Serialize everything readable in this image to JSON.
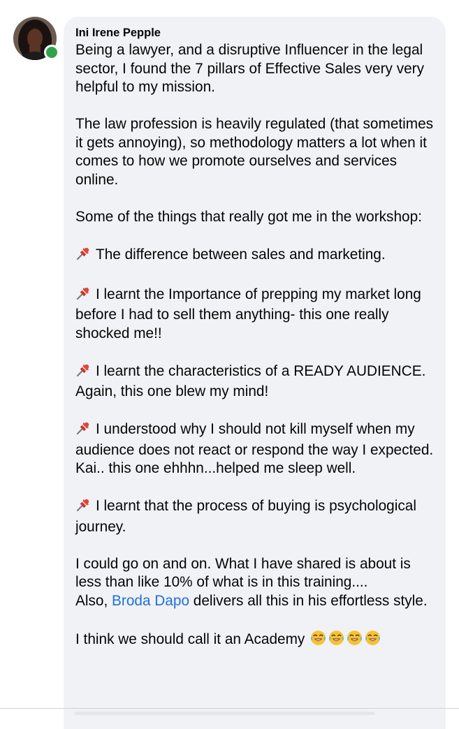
{
  "comment": {
    "author": "Ini Irene Pepple",
    "online": true,
    "paragraphs": [
      {
        "pinned": false,
        "text": "Being a lawyer, and a disruptive Influencer  in the legal sector, I found the 7 pillars of Effective Sales very very helpful to my mission."
      },
      {
        "pinned": false,
        "text": "The law profession is heavily regulated (that sometimes it gets annoying), so methodology matters a lot when it comes to how we promote ourselves and services online."
      },
      {
        "pinned": false,
        "text": "Some of the things that really got me in the workshop:"
      },
      {
        "pinned": true,
        "text": "The difference between sales and marketing."
      },
      {
        "pinned": true,
        "text": "I learnt the Importance of prepping my market long before I had to sell them anything- this one really shocked me!!"
      },
      {
        "pinned": true,
        "text": "I learnt the characteristics of a READY AUDIENCE. Again, this one blew my mind!"
      },
      {
        "pinned": true,
        "text": "I understood why I should not kill myself when my audience does not react or respond the way I expected. Kai.. this one ehhhn...helped me sleep well."
      },
      {
        "pinned": true,
        "text": "I learnt that the process of buying is psychological journey."
      },
      {
        "pinned": false,
        "text": "I could go on and on. What I have shared is about is less than like 10% of what is in this training...."
      }
    ],
    "mention_paragraph": {
      "before": "Also, ",
      "mention": "Broda Dapo",
      "after": " delivers all this in his effortless style."
    },
    "closing": {
      "text": "I think we should call it an Academy",
      "emoji_count": 4,
      "emoji_name": "face-with-tears-of-joy-icon"
    }
  },
  "icons": {
    "pin": "pushpin-icon",
    "avatar": "profile-photo",
    "status": "online-status-dot"
  },
  "colors": {
    "bubble_background": "#f0f2f5",
    "text": "#050505",
    "mention": "#216fdb",
    "online": "#31a24c",
    "pin": "#d93a2b",
    "emoji_face": "#f7c233"
  }
}
